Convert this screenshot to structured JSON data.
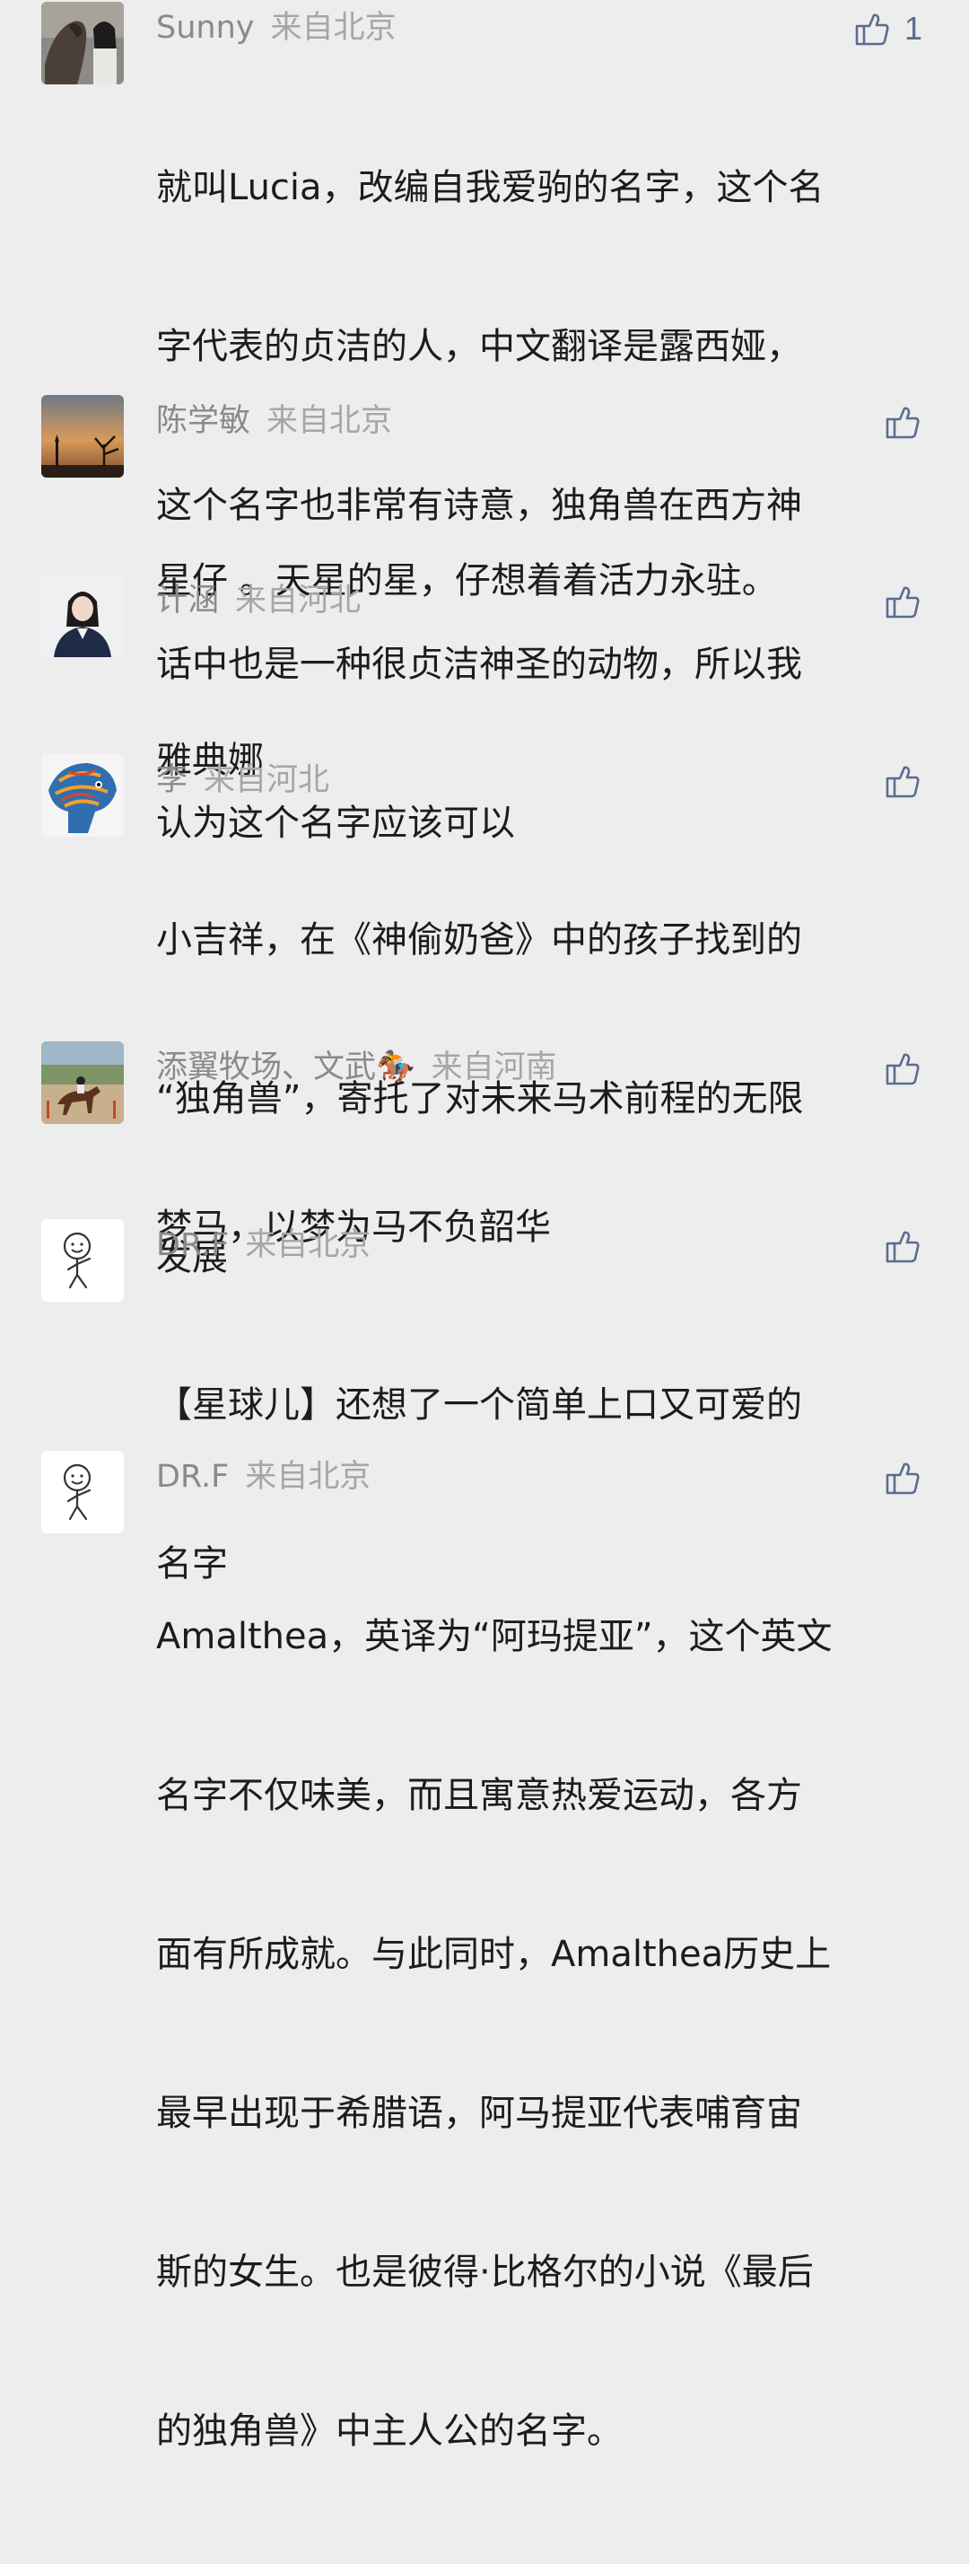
{
  "comments": [
    {
      "username": "Sunny",
      "location": "来自北京",
      "like_count": "1",
      "content_lines": [
        "就叫Lucia，改编自我爱驹的名字，这个名",
        "字代表的贞洁的人，中文翻译是露西娅，",
        "这个名字也非常有诗意，独角兽在西方神",
        "话中也是一种很贞洁神圣的动物，所以我",
        "认为这个名字应该可以"
      ]
    },
    {
      "username": "陈学敏",
      "location": "来自北京",
      "like_count": "",
      "content_lines": [
        "星仔 。天星的星，仔想着着活力永驻。"
      ]
    },
    {
      "username": "计涵",
      "location": "来自河北",
      "like_count": "",
      "content_lines": [
        "雅典娜"
      ]
    },
    {
      "username": "李",
      "location": "来自河北",
      "like_count": "",
      "content_lines": [
        "小吉祥，在《神偷奶爸》中的孩子找到的",
        "“独角兽”，寄托了对未来马术前程的无限",
        "发展"
      ]
    },
    {
      "username": "添翼牧场、文武🏇",
      "location": "来自河南",
      "like_count": "",
      "content_lines": [
        "梦马，以梦为马不负韶华"
      ]
    },
    {
      "username": "DR.F",
      "location": "来自北京",
      "like_count": "",
      "content_lines": [
        "【星球儿】还想了一个简单上口又可爱的",
        "名字"
      ]
    },
    {
      "username": "DR.F",
      "location": "来自北京",
      "like_count": "",
      "content_lines": [
        "Amalthea，英译为“阿玛提亚”，这个英文",
        "名字不仅味美，而且寓意热爱运动，各方",
        "面有所成就。与此同时，Amalthea历史上",
        "最早出现于希腊语，阿马提亚代表哺育宙",
        "斯的女生。也是彼得·比格尔的小说《最后",
        "的独角兽》中主人公的名字。"
      ]
    }
  ],
  "icons": {
    "like": "thumbs-up-icon"
  },
  "colors": {
    "background": "#ededed",
    "meta_text": "#8a8a8a",
    "content_text": "#1c1c1c",
    "like_icon": "#5b6c8f"
  }
}
